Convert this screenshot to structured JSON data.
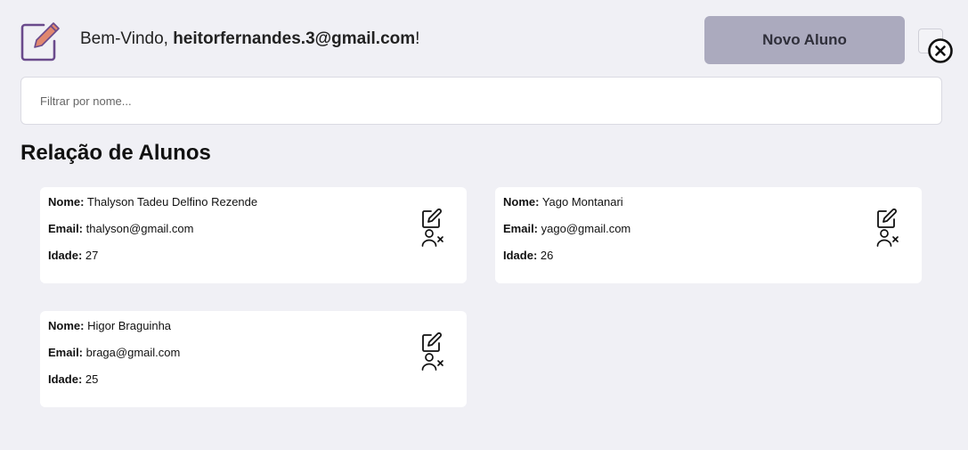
{
  "header": {
    "logo_icon": "edit-note-icon",
    "welcome_prefix": "Bem-Vindo, ",
    "user_email": "heitorfernandes.3@gmail.com",
    "welcome_suffix": "!",
    "new_button_label": "Novo Aluno",
    "close_icon": "close-circle-icon"
  },
  "search": {
    "placeholder": "Filtrar por nome...",
    "value": ""
  },
  "section": {
    "title": "Relação de Alunos"
  },
  "labels": {
    "name": "Nome:",
    "email": "Email:",
    "age": "Idade:"
  },
  "students": [
    {
      "name": "Thalyson Tadeu Delfino Rezende",
      "email": "thalyson@gmail.com",
      "age": "27"
    },
    {
      "name": "Yago Montanari",
      "email": "yago@gmail.com",
      "age": "26"
    },
    {
      "name": "Higor Braguinha",
      "email": "braga@gmail.com",
      "age": "25"
    }
  ],
  "icons": {
    "edit": "edit-icon",
    "remove": "user-remove-icon"
  },
  "colors": {
    "background": "#f0f0f5",
    "accent_purple": "#6a4a8c",
    "logo_pencil": "#e0876f",
    "button_bg": "#abaabe",
    "card_bg": "#ffffff"
  }
}
